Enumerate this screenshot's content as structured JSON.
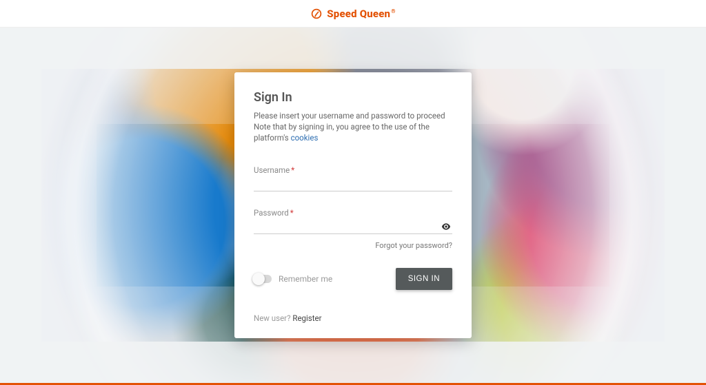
{
  "brand": {
    "name": "Speed Queen"
  },
  "card": {
    "title": "Sign In",
    "subtitle_line1": "Please insert your username and password to proceed",
    "subtitle_line2_prefix": "Note that by signing in, you agree to the use of the platform's ",
    "cookies_link": "cookies",
    "username_label": "Username",
    "password_label": "Password",
    "required_mark": "*",
    "forgot_label": "Forgot your password?",
    "remember_label": "Remember me",
    "signin_button": "SIGN IN",
    "newuser_prefix": "New user? ",
    "register_link": "Register"
  }
}
